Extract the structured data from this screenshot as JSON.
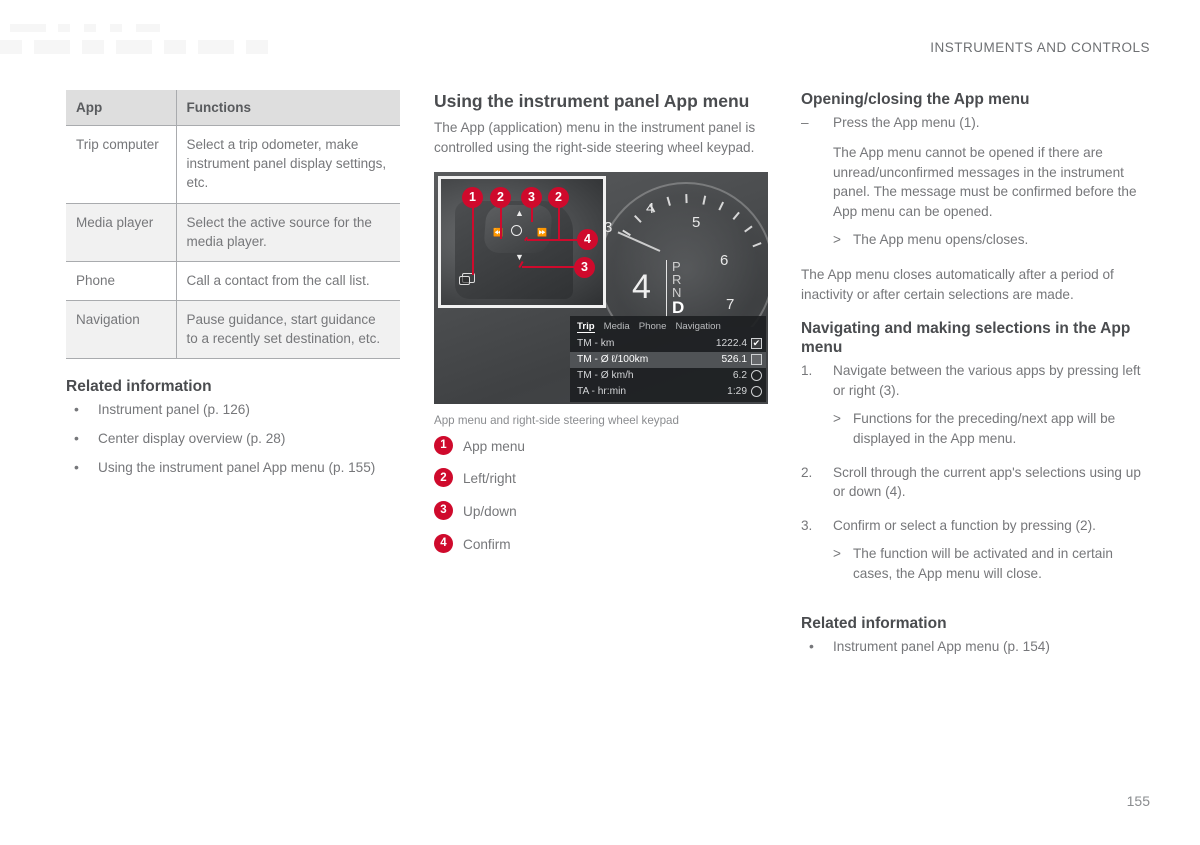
{
  "header": {
    "chapter_title": "INSTRUMENTS AND CONTROLS",
    "page_number": "155"
  },
  "left_column": {
    "table": {
      "headers": [
        "App",
        "Functions"
      ],
      "rows": [
        {
          "app": "Trip computer",
          "functions": "Select a trip odometer, make instrument panel display settings, etc."
        },
        {
          "app": "Media player",
          "functions": "Select the active source for the media player."
        },
        {
          "app": "Phone",
          "functions": "Call a contact from the call list."
        },
        {
          "app": "Navigation",
          "functions": "Pause guidance, start guidance to a recently set destination, etc."
        }
      ]
    },
    "related": {
      "title": "Related information",
      "items": [
        "Instrument panel (p. 126)",
        "Center display overview (p. 28)",
        "Using the instrument panel App menu (p. 155)"
      ]
    }
  },
  "middle_column": {
    "section_title": "Using the instrument panel App menu",
    "intro": "The App (application) menu in the instrument panel is controlled using the right-side steering wheel keypad.",
    "figure": {
      "caption": "App menu and right-side steering wheel keypad",
      "callouts": [
        "1",
        "2",
        "3",
        "2",
        "4",
        "3"
      ],
      "gauge": {
        "tick_labels": [
          "3",
          "4",
          "5",
          "6",
          "7"
        ],
        "gear_digit": "4",
        "gear_modes": [
          "P",
          "R",
          "N",
          "D"
        ],
        "gear_active": "D"
      },
      "trip_menu": {
        "tabs": [
          "Trip",
          "Media",
          "Phone",
          "Navigation"
        ],
        "selected_tab": "Trip",
        "rows": [
          {
            "label": "TM - km",
            "value": "1222.4",
            "control": "checkbox-checked"
          },
          {
            "label": "TM - Ø ℓ/100km",
            "value": "526.1",
            "control": "checkbox-empty"
          },
          {
            "label": "TM - Ø km/h",
            "value": "6.2",
            "control": "radio"
          },
          {
            "label": "TA - hr:min",
            "value": "1:29",
            "control": "radio"
          }
        ]
      }
    },
    "legend": [
      {
        "num": "1",
        "label": "App menu"
      },
      {
        "num": "2",
        "label": "Left/right"
      },
      {
        "num": "3",
        "label": "Up/down"
      },
      {
        "num": "4",
        "label": "Confirm"
      }
    ]
  },
  "right_column": {
    "open_close": {
      "title": "Opening/closing the App menu",
      "dash_item": "Press the App menu (1).",
      "note": "The App menu cannot be opened if there are unread/unconfirmed messages in the instrument panel. The message must be confirmed before the App menu can be opened.",
      "result": "The App menu opens/closes.",
      "paragraph": "The App menu closes automatically after a period of inactivity or after certain selections are made."
    },
    "navigating": {
      "title": "Navigating and making selections in the App menu",
      "steps": [
        {
          "num": "1.",
          "text": "Navigate between the various apps by pressing left or right (3).",
          "result": "Functions for the preceding/next app will be displayed in the App menu."
        },
        {
          "num": "2.",
          "text": "Scroll through the current app's selections using up or down (4).",
          "result": ""
        },
        {
          "num": "3.",
          "text": "Confirm or select a function by pressing (2).",
          "result": "The function will be activated and in certain cases, the App menu will close."
        }
      ]
    },
    "related": {
      "title": "Related information",
      "items": [
        "Instrument panel App menu (p. 154)"
      ]
    }
  },
  "colors": {
    "accent_red": "#cf0a2c",
    "table_header_bg": "#dedede",
    "table_shade_bg": "#f1f1f1",
    "body_text": "#76777a",
    "heading_text": "#4a4c4f"
  }
}
